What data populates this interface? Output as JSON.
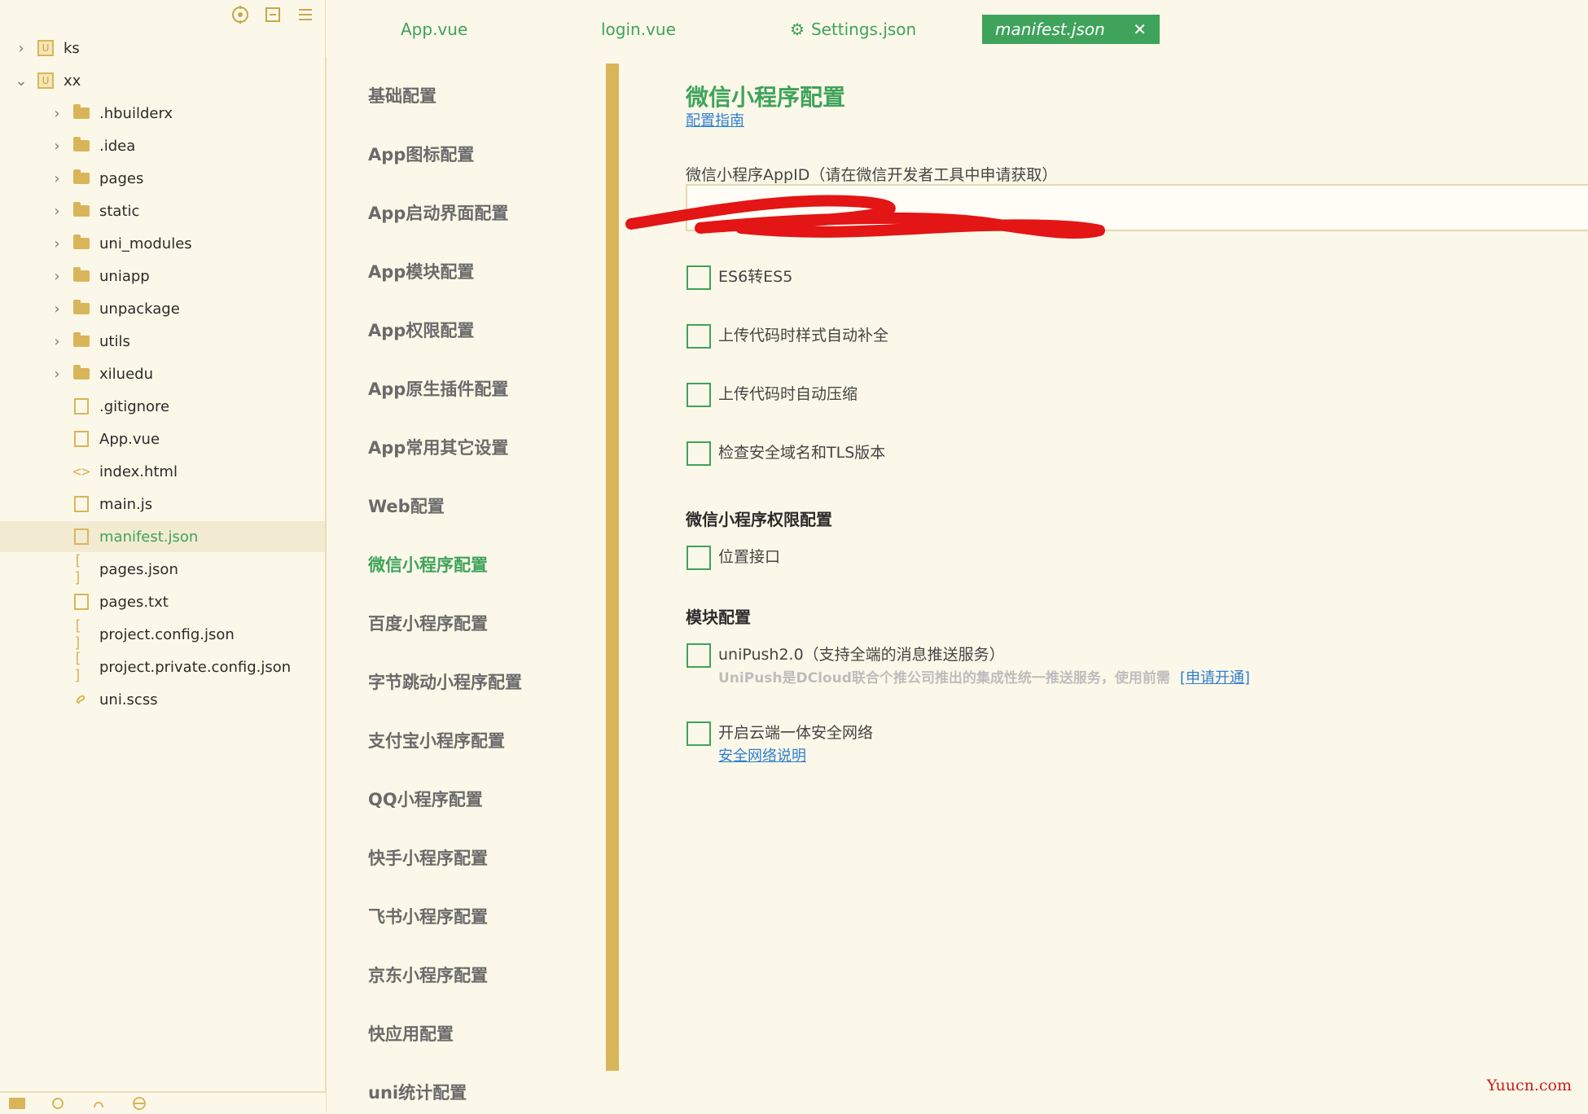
{
  "sidebar": {
    "tools": [
      {
        "name": "locate-icon"
      },
      {
        "name": "collapse-all-icon"
      },
      {
        "name": "menu-icon"
      }
    ],
    "tree": [
      {
        "label": "ks",
        "type": "project",
        "expanded": false
      },
      {
        "label": "xx",
        "type": "project",
        "expanded": true
      },
      {
        "label": ".hbuilderx",
        "type": "folder"
      },
      {
        "label": ".idea",
        "type": "folder"
      },
      {
        "label": "pages",
        "type": "folder"
      },
      {
        "label": "static",
        "type": "folder"
      },
      {
        "label": "uni_modules",
        "type": "folder"
      },
      {
        "label": "uniapp",
        "type": "folder"
      },
      {
        "label": "unpackage",
        "type": "folder"
      },
      {
        "label": "utils",
        "type": "folder"
      },
      {
        "label": "xiluedu",
        "type": "folder"
      },
      {
        "label": ".gitignore",
        "type": "file"
      },
      {
        "label": "App.vue",
        "type": "vue"
      },
      {
        "label": "index.html",
        "type": "html"
      },
      {
        "label": "main.js",
        "type": "js"
      },
      {
        "label": "manifest.json",
        "type": "manifest",
        "active": true
      },
      {
        "label": "pages.json",
        "type": "json"
      },
      {
        "label": "pages.txt",
        "type": "file"
      },
      {
        "label": "project.config.json",
        "type": "json"
      },
      {
        "label": "project.private.config.json",
        "type": "json"
      },
      {
        "label": "uni.scss",
        "type": "scss"
      }
    ]
  },
  "tabs": [
    {
      "label": "App.vue"
    },
    {
      "label": "login.vue"
    },
    {
      "label": "Settings.json",
      "icon": "gear-icon"
    },
    {
      "label": "manifest.json",
      "active": true
    }
  ],
  "nav": [
    "基础配置",
    "App图标配置",
    "App启动界面配置",
    "App模块配置",
    "App权限配置",
    "App原生插件配置",
    "App常用其它设置",
    "Web配置",
    "微信小程序配置",
    "百度小程序配置",
    "字节跳动小程序配置",
    "支付宝小程序配置",
    "QQ小程序配置",
    "快手小程序配置",
    "飞书小程序配置",
    "京东小程序配置",
    "快应用配置",
    "uni统计配置"
  ],
  "content": {
    "title": "微信小程序配置",
    "guide_link": "配置指南",
    "appid_label": "微信小程序AppID（请在微信开发者工具中申请获取）",
    "options": [
      "ES6转ES5",
      "上传代码时样式自动补全",
      "上传代码时自动压缩",
      "检查安全域名和TLS版本"
    ],
    "permission_section": "微信小程序权限配置",
    "permission_option": "位置接口",
    "module_section": "模块配置",
    "unipush_label": "uniPush2.0（支持全端的消息推送服务）",
    "unipush_desc": "UniPush是DCloud联合个推公司推出的集成性统一推送服务，使用前需",
    "unipush_link": "[申请开通]",
    "secure_label": "开启云端一体安全网络",
    "secure_link": "安全网络说明",
    "watermark": "Yuucn.com"
  },
  "colors": {
    "accent": "#3FA35B",
    "background": "#FCF8E9",
    "folder": "#D9B55A",
    "link": "#2F7FD1",
    "redaction": "#E31515"
  }
}
